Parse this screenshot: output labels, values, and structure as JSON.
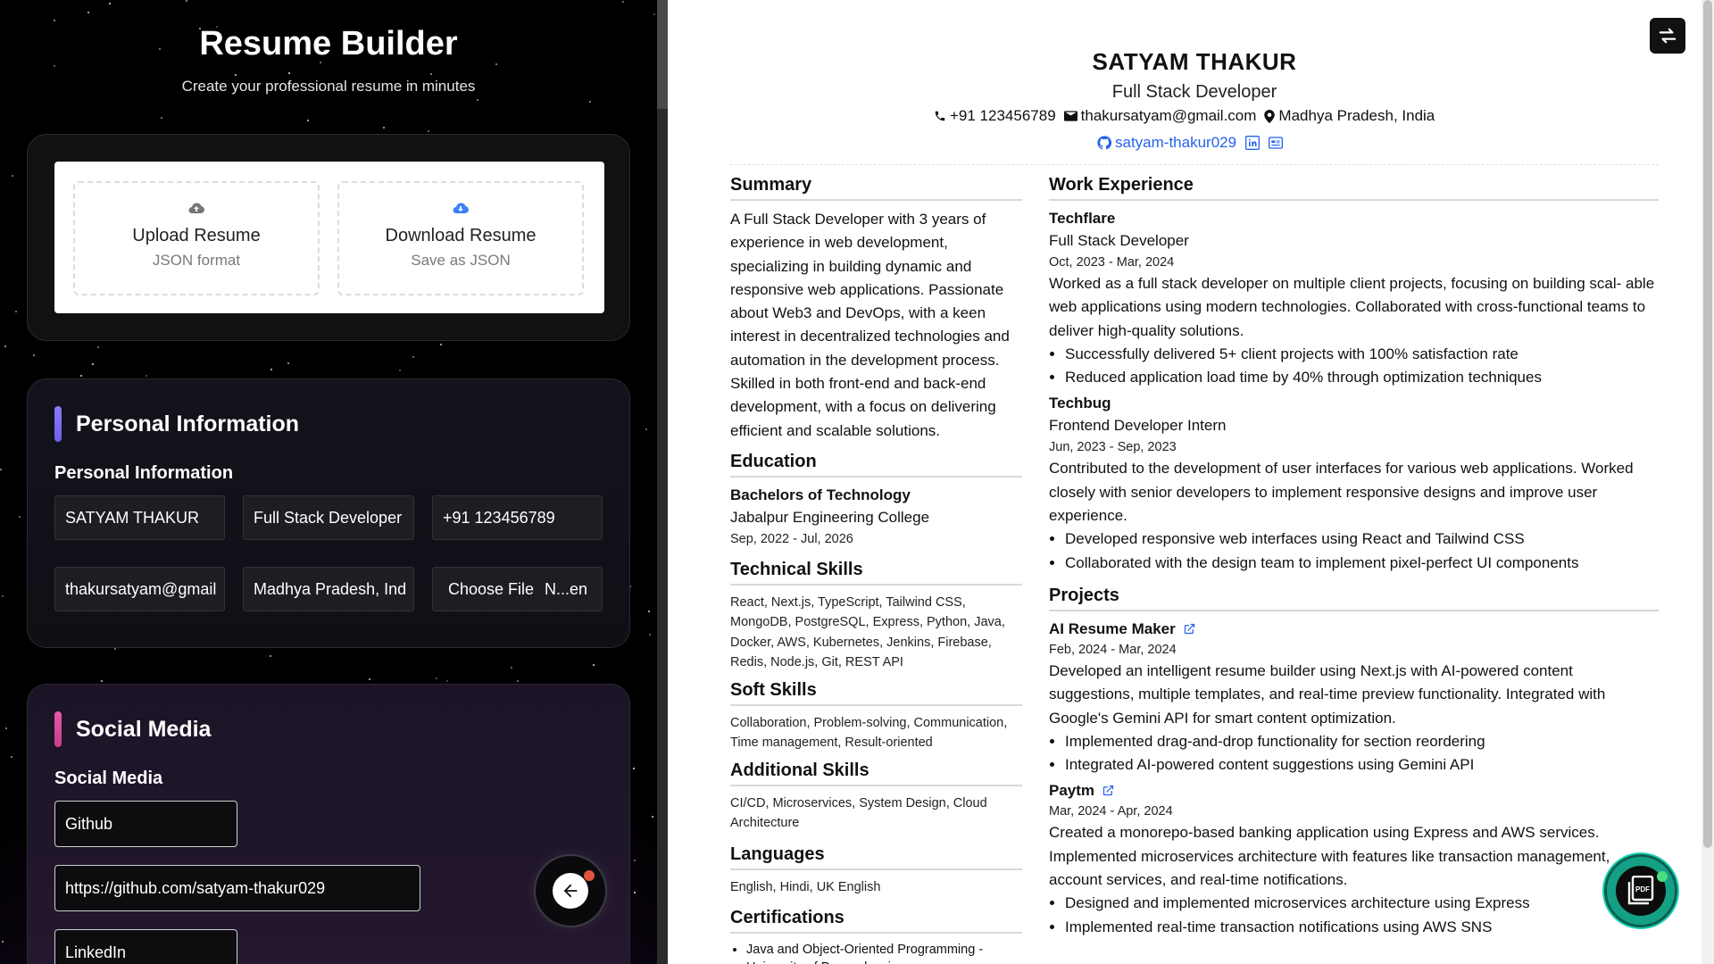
{
  "app": {
    "title": "Resume Builder",
    "subtitle": "Create your professional resume in minutes"
  },
  "io": {
    "upload_label": "Upload Resume",
    "upload_sub": "JSON format",
    "download_label": "Download Resume",
    "download_sub": "Save as JSON",
    "upload_icon": "cloud-upload-icon",
    "download_icon": "cloud-download-icon"
  },
  "personal": {
    "section_title": "Personal Information",
    "sub_title": "Personal Information",
    "accent": "#8b7bf5",
    "fields": {
      "name": "SATYAM THAKUR",
      "title": "Full Stack Developer",
      "phone": "+91 123456789",
      "email": "thakursatyam@gmail",
      "location": "Madhya Pradesh, Ind",
      "file_button": "Choose File",
      "file_name": "N...en"
    }
  },
  "social": {
    "section_title": "Social Media",
    "sub_title": "Social Media",
    "accent": "#e85aa8",
    "fields": {
      "platform1": "Github",
      "url1": "https://github.com/satyam-thakur029",
      "platform2": "LinkedIn"
    }
  },
  "resume": {
    "name": "SATYAM THAKUR",
    "role": "Full Stack Developer",
    "phone": "+91 123456789",
    "email": "thakursatyam@gmail.com",
    "location": "Madhya Pradesh, India",
    "github": "satyam-thakur029",
    "link_color": "#2563eb",
    "summary_heading": "Summary",
    "summary": "A Full Stack Developer with 3 years of experience in web development, specializing in building dynamic and responsive web applications. Passionate about Web3 and DevOps, with a keen interest in decentralized technologies and automation in the development process. Skilled in both front-end and back-end development, with a focus on delivering efficient and scalable solutions.",
    "education_heading": "Education",
    "education": {
      "degree": "Bachelors of Technology",
      "school": "Jabalpur Engineering College",
      "dates": "Sep, 2022 - Jul, 2026"
    },
    "tech_heading": "Technical Skills",
    "tech_skills": "React, Next.js, TypeScript, Tailwind CSS, MongoDB, PostgreSQL, Express, Python, Java, Docker, AWS, Kubernetes, Jenkins, Firebase, Redis, Node.js, Git, REST API",
    "soft_heading": "Soft Skills",
    "soft_skills": "Collaboration, Problem-solving, Communication, Time management, Result-oriented",
    "additional_heading": "Additional Skills",
    "additional_skills": "CI/CD, Microservices, System Design, Cloud Architecture",
    "languages_heading": "Languages",
    "languages": "English, Hindi, UK English",
    "certs_heading": "Certifications",
    "certs": [
      "Java and Object-Oriented Programming - University of Pennsylvania"
    ],
    "work_heading": "Work Experience",
    "work": [
      {
        "company": "Techflare",
        "title": "Full Stack Developer",
        "dates": "Oct, 2023 - Mar, 2024",
        "desc": "Worked as a full stack developer on multiple client projects, focusing on building scal- able web applications using modern technologies. Collaborated with cross-functional teams to deliver high-quality solutions.",
        "bullets": [
          "Successfully delivered 5+ client projects with 100% satisfaction rate",
          "Reduced application load time by 40% through optimization techniques"
        ]
      },
      {
        "company": "Techbug",
        "title": "Frontend Developer Intern",
        "dates": "Jun, 2023 - Sep, 2023",
        "desc": "Contributed to the development of user interfaces for various web applications. Worked closely with senior developers to implement responsive designs and improve user experience.",
        "bullets": [
          "Developed responsive web interfaces using React and Tailwind CSS",
          "Collaborated with the design team to implement pixel-perfect UI components"
        ]
      }
    ],
    "projects_heading": "Projects",
    "projects": [
      {
        "name": "AI Resume Maker",
        "dates": "Feb, 2024 - Mar, 2024",
        "desc": "Developed an intelligent resume builder using Next.js with AI-powered content suggestions, multiple templates, and real-time preview functionality. Integrated with Google's Gemini API for smart content optimization.",
        "bullets": [
          "Implemented drag-and-drop functionality for section reordering",
          "Integrated AI-powered content suggestions using Gemini API"
        ]
      },
      {
        "name": "Paytm",
        "dates": "Mar, 2024 - Apr, 2024",
        "desc": "Created a monorepo-based banking application using Express and AWS services. Implemented microservices architecture with features like transaction management, account services, and real-time notifications.",
        "bullets": [
          "Designed and implemented microservices architecture using Express",
          "Implemented real-time transaction notifications using AWS SNS"
        ]
      }
    ]
  },
  "controls": {
    "back_icon": "arrow-left-icon",
    "swap_icon": "swap-arrows-icon",
    "pdf_label": "PDF"
  }
}
